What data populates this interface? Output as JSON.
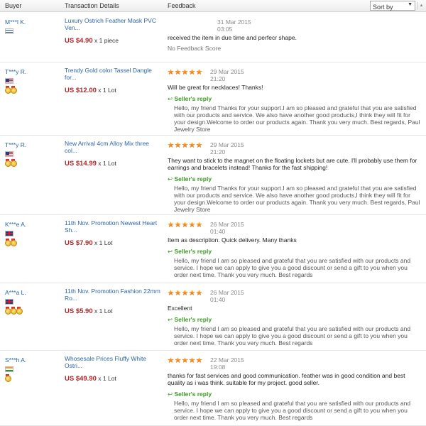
{
  "header": {
    "buyer": "Buyer",
    "transaction": "Transaction Details",
    "feedback": "Feedback",
    "sort_by": "Sort by"
  },
  "rows": [
    {
      "buyer": "M***l K.",
      "flag": "il",
      "medals": 0,
      "product": "Luxury Ostrich Feather Mask PVC Ven...",
      "price": "US $4.90",
      "qty": "x 1 piece",
      "stars": 0,
      "date": "31 Mar 2015",
      "time": "03:05",
      "comment": "received the item in due time and perfecr shape.",
      "no_score": "No Feedback Score",
      "reply": ""
    },
    {
      "buyer": "T***y R.",
      "flag": "us",
      "medals": 2,
      "product": "Trendy Gold color Tassel Dangle for...",
      "price": "US $12.00",
      "qty": "x 1 Lot",
      "stars": 5,
      "date": "29 Mar 2015",
      "time": "21:20",
      "comment": "Will be great for necklaces! Thanks!",
      "reply_label": "Seller's reply",
      "reply": "Hello, my friend Thanks for your support.I am so pleased and grateful that you are satisfied with our products and service. We also have another good products,I think they will fit for your design.Welcome to order our products again. Thank you very much. Best regards, Paul Jewelry Store"
    },
    {
      "buyer": "T***y R.",
      "flag": "us",
      "medals": 2,
      "product": "New Arrival 4cm Alloy Mix three col...",
      "price": "US $14.99",
      "qty": "x 1 Lot",
      "stars": 5,
      "date": "29 Mar 2015",
      "time": "21:20",
      "comment": "They want to stick to the magnet on the floating lockets but are cute. I'll probably use them for earrings and bracelets instead! Thanks for the fast shipping!",
      "reply_label": "Seller's reply",
      "reply": "Hello, my friend Thanks for your support.I am so pleased and grateful that you are satisfied with our products and service. We also have another good products,I think they will fit for your design.Welcome to order our products again. Thank you very much. Best regards, Paul Jewelry Store"
    },
    {
      "buyer": "K***e A.",
      "flag": "gb",
      "medals": 2,
      "product": "11th Nov. Promotion Newest Heart Sh...",
      "price": "US $7.90",
      "qty": "x 1 Lot",
      "stars": 5,
      "date": "26 Mar 2015",
      "time": "01:40",
      "comment": "Item as description. Quick delivery. Many thanks",
      "reply_label": "Seller's reply",
      "reply": "Hello, my friend I am so pleased and grateful that you are satisfied with our products and service. I hope we can apply to give you a good discount or send a gift to you when you order next time. Thank you very much. Best regards"
    },
    {
      "buyer": "A***a L.",
      "flag": "gb",
      "medals": 3,
      "product": "11th Nov. Promotion Fashion 22mm Ro...",
      "price": "US $5.90",
      "qty": "x 1 Lot",
      "stars": 5,
      "date": "26 Mar 2015",
      "time": "01:40",
      "comment": "Excellent",
      "reply_label": "Seller's reply",
      "reply": "Hello, my friend I am so pleased and grateful that you are satisfied with our products and service. I hope we can apply to give you a good discount or send a gift to you when you order next time. Thank you very much. Best regards"
    },
    {
      "buyer": "S***h A.",
      "flag": "in",
      "medals": 1,
      "product": "Whosesale Prices Fluffy White Ostri...",
      "price": "US $49.90",
      "qty": "x 1 Lot",
      "stars": 5,
      "date": "22 Mar 2015",
      "time": "19:08",
      "comment": "thanks for fast services and good communication. feather was in good condition and best quality as i was think. suitable for my project. good seller.",
      "reply_label": "Seller's reply",
      "reply": "Hello, my friend I am so pleased and grateful that you are satisfied with our products and service. I hope we can apply to give you a good discount or send a gift to you when you order next time. Thank you very much. Best regards"
    }
  ]
}
